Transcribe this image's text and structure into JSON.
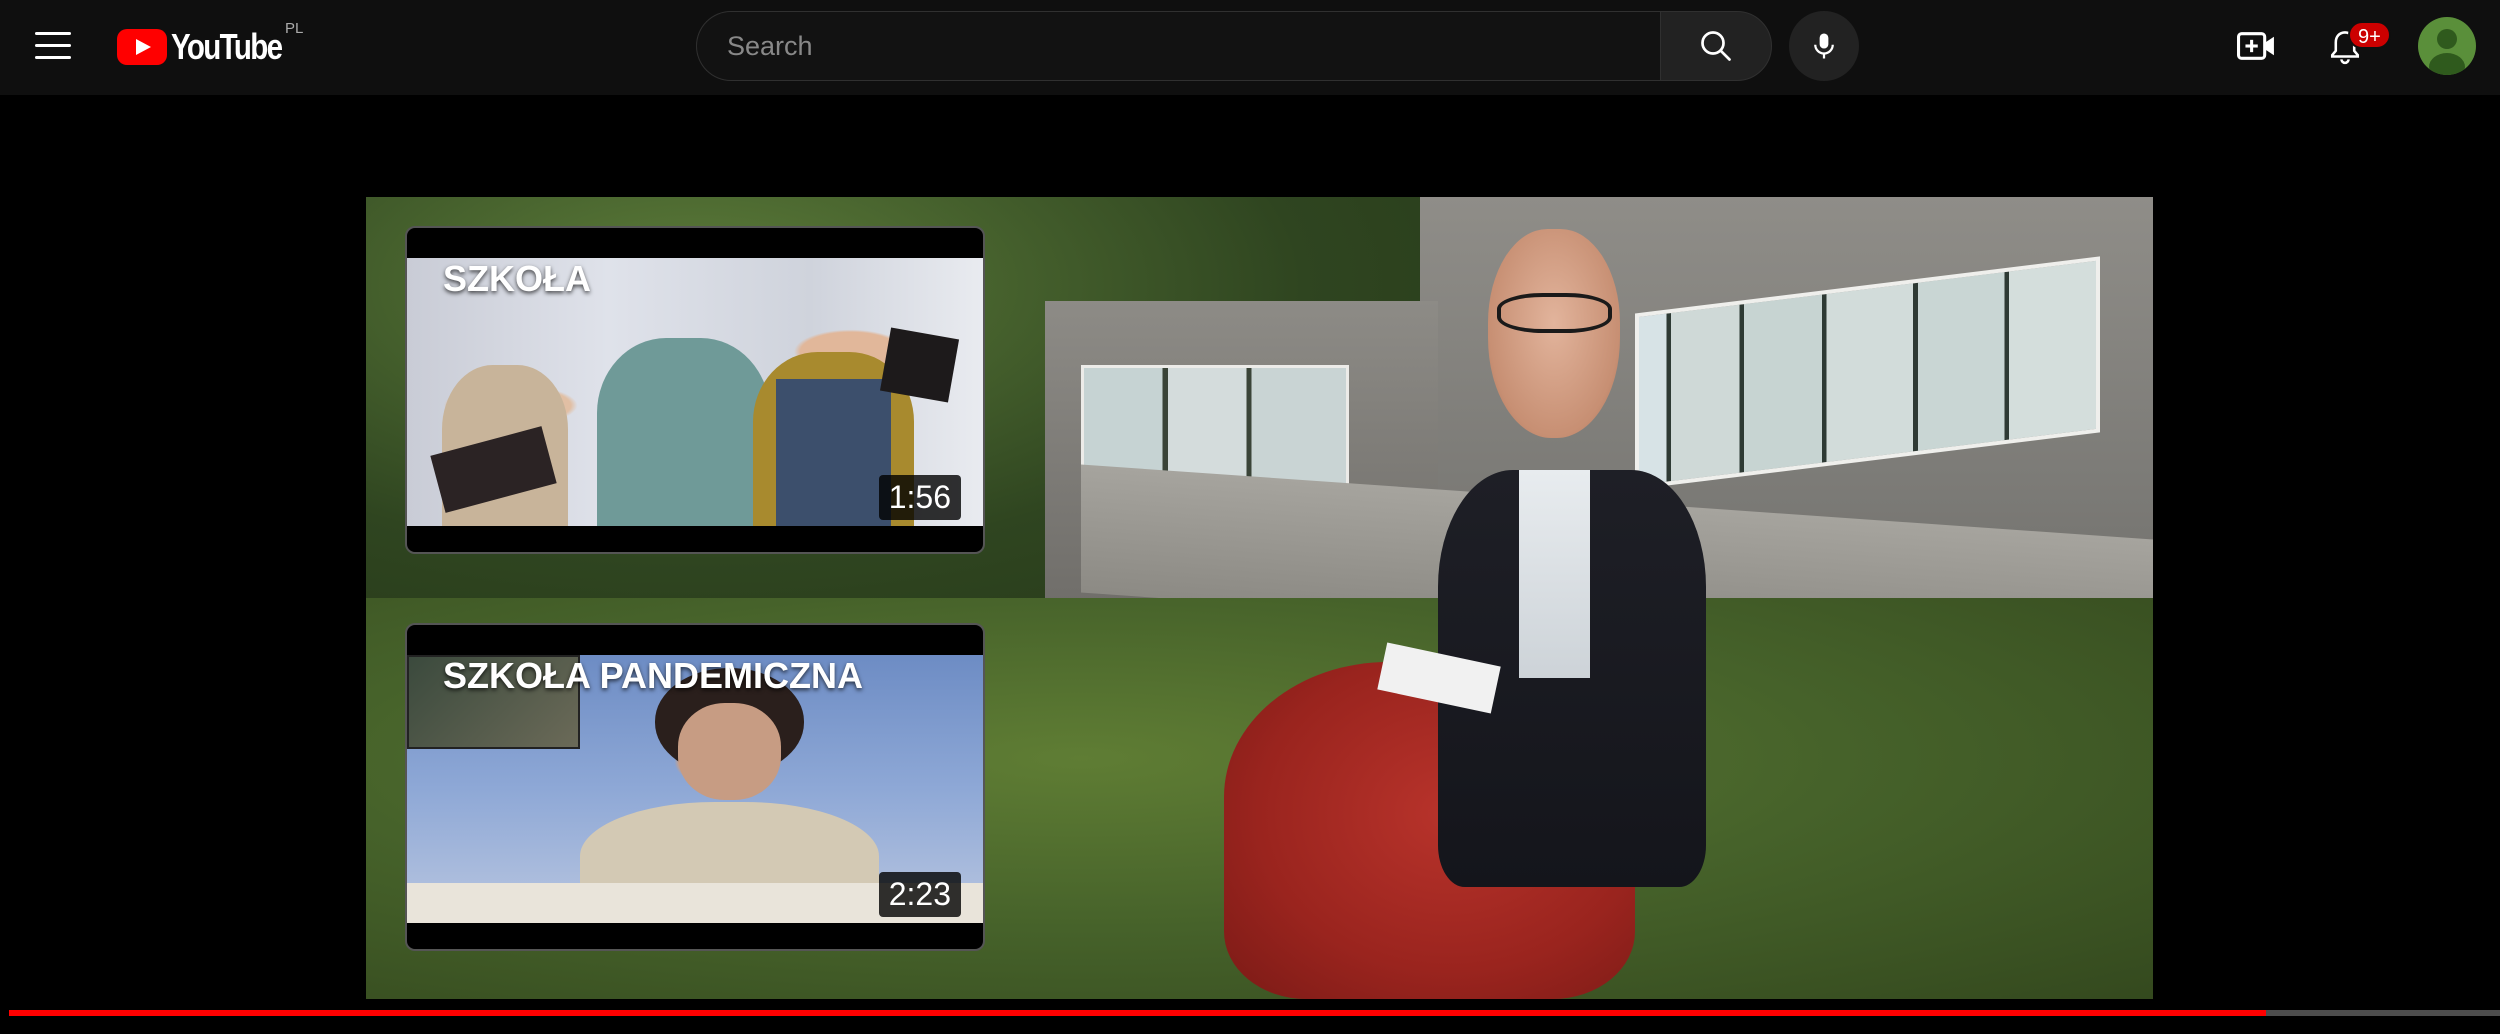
{
  "header": {
    "logo_text": "YouTube",
    "country_code": "PL",
    "search": {
      "placeholder": "Search",
      "value": ""
    },
    "notifications_badge": "9+"
  },
  "player": {
    "progress_fraction": 0.906
  },
  "endscreen": {
    "cards": [
      {
        "title": "SZKOŁA",
        "duration": "1:56"
      },
      {
        "title": "SZKOŁA PANDEMICZNA",
        "duration": "2:23"
      }
    ]
  },
  "icons": {
    "menu": "hamburger-menu-icon",
    "logo": "youtube-play-icon",
    "search": "search-icon",
    "mic": "microphone-icon",
    "create": "create-video-icon",
    "notifications": "bell-icon",
    "avatar": "avatar-icon"
  },
  "colors": {
    "brand_red": "#ff0000",
    "masthead_bg": "#0f0f0f",
    "badge_red": "#cc0000",
    "avatar_green": "#5a8f3a"
  }
}
